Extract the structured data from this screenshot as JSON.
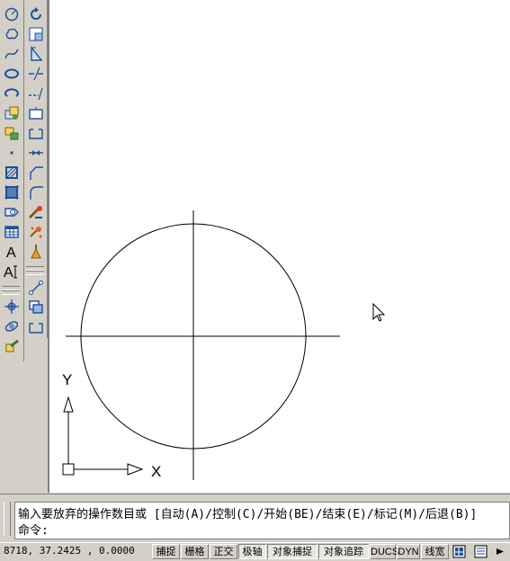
{
  "command_window": {
    "line1": "输入要放弃的操作数目或 [自动(A)/控制(C)/开始(BE)/结束(E)/标记(M)/后退(B)]",
    "line2": "命令:"
  },
  "status_bar": {
    "coordinates": "8718,  37.2425 , 0.0000",
    "buttons": [
      "捕捉",
      "栅格",
      "正交",
      "极轴",
      "对象捕捉",
      "对象追踪",
      "DUCS",
      "DYN",
      "线宽"
    ]
  },
  "canvas": {
    "ucs_x_label": "X",
    "ucs_y_label": "Y"
  },
  "colors": {
    "background": "#ffffff",
    "chrome": "#d4d0c8",
    "icon_blue": "#1c4f9c"
  },
  "toolbars": {
    "draw": [
      "circle-icon",
      "revision-cloud-icon",
      "spline-icon",
      "ellipse-icon",
      "ellipse-arc-icon",
      "insert-block-icon",
      "make-block-icon",
      "point-icon",
      "hatch-icon",
      "gradient-icon",
      "region-icon",
      "table-icon",
      "text-icon",
      "multiline-text-icon",
      "orbit-icon",
      "free-orbit-icon",
      "render-icon"
    ],
    "modify": [
      "rotate-icon",
      "scale-icon",
      "stretch-icon",
      "trim-icon",
      "extend-icon",
      "break-at-point-icon",
      "break-icon",
      "join-icon",
      "chamfer-icon",
      "fillet-icon",
      "explode-icon",
      "lamp-icon",
      "paint-icon",
      "polyline-edit-icon",
      "copy-icon",
      "array-icon"
    ]
  }
}
